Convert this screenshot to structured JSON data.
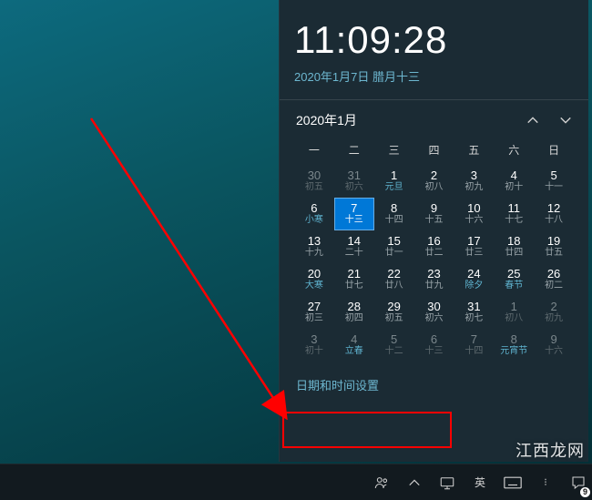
{
  "clock": {
    "time": "11:09:28",
    "date_line": "2020年1月7日 腊月十三"
  },
  "calendar": {
    "month_label": "2020年1月",
    "dow": [
      "一",
      "二",
      "三",
      "四",
      "五",
      "六",
      "日"
    ],
    "weeks": [
      [
        {
          "n": "30",
          "s": "初五",
          "cls": "other"
        },
        {
          "n": "31",
          "s": "初六",
          "cls": "other"
        },
        {
          "n": "1",
          "s": "元旦",
          "cls": "cur hol"
        },
        {
          "n": "2",
          "s": "初八",
          "cls": "cur"
        },
        {
          "n": "3",
          "s": "初九",
          "cls": "cur"
        },
        {
          "n": "4",
          "s": "初十",
          "cls": "cur"
        },
        {
          "n": "5",
          "s": "十一",
          "cls": "cur"
        }
      ],
      [
        {
          "n": "6",
          "s": "小寒",
          "cls": "cur hol"
        },
        {
          "n": "7",
          "s": "十三",
          "cls": "cur today"
        },
        {
          "n": "8",
          "s": "十四",
          "cls": "cur"
        },
        {
          "n": "9",
          "s": "十五",
          "cls": "cur"
        },
        {
          "n": "10",
          "s": "十六",
          "cls": "cur"
        },
        {
          "n": "11",
          "s": "十七",
          "cls": "cur"
        },
        {
          "n": "12",
          "s": "十八",
          "cls": "cur"
        }
      ],
      [
        {
          "n": "13",
          "s": "十九",
          "cls": "cur"
        },
        {
          "n": "14",
          "s": "二十",
          "cls": "cur"
        },
        {
          "n": "15",
          "s": "廿一",
          "cls": "cur"
        },
        {
          "n": "16",
          "s": "廿二",
          "cls": "cur"
        },
        {
          "n": "17",
          "s": "廿三",
          "cls": "cur"
        },
        {
          "n": "18",
          "s": "廿四",
          "cls": "cur"
        },
        {
          "n": "19",
          "s": "廿五",
          "cls": "cur"
        }
      ],
      [
        {
          "n": "20",
          "s": "大寒",
          "cls": "cur hol"
        },
        {
          "n": "21",
          "s": "廿七",
          "cls": "cur"
        },
        {
          "n": "22",
          "s": "廿八",
          "cls": "cur"
        },
        {
          "n": "23",
          "s": "廿九",
          "cls": "cur"
        },
        {
          "n": "24",
          "s": "除夕",
          "cls": "cur hol"
        },
        {
          "n": "25",
          "s": "春节",
          "cls": "cur hol"
        },
        {
          "n": "26",
          "s": "初二",
          "cls": "cur"
        }
      ],
      [
        {
          "n": "27",
          "s": "初三",
          "cls": "cur"
        },
        {
          "n": "28",
          "s": "初四",
          "cls": "cur"
        },
        {
          "n": "29",
          "s": "初五",
          "cls": "cur"
        },
        {
          "n": "30",
          "s": "初六",
          "cls": "cur"
        },
        {
          "n": "31",
          "s": "初七",
          "cls": "cur"
        },
        {
          "n": "1",
          "s": "初八",
          "cls": "other"
        },
        {
          "n": "2",
          "s": "初九",
          "cls": "other"
        }
      ],
      [
        {
          "n": "3",
          "s": "初十",
          "cls": "other"
        },
        {
          "n": "4",
          "s": "立春",
          "cls": "other hol"
        },
        {
          "n": "5",
          "s": "十二",
          "cls": "other"
        },
        {
          "n": "6",
          "s": "十三",
          "cls": "other"
        },
        {
          "n": "7",
          "s": "十四",
          "cls": "other"
        },
        {
          "n": "8",
          "s": "元宵节",
          "cls": "other hol"
        },
        {
          "n": "9",
          "s": "十六",
          "cls": "other"
        }
      ]
    ]
  },
  "links": {
    "date_time_settings": "日期和时间设置"
  },
  "tray": {
    "chevron_title": "显示隐藏的图标",
    "people_title": "人脉",
    "ime_lang": "英",
    "ime_mode": "⁝",
    "notification_count": "9"
  },
  "watermark": "江西龙网"
}
